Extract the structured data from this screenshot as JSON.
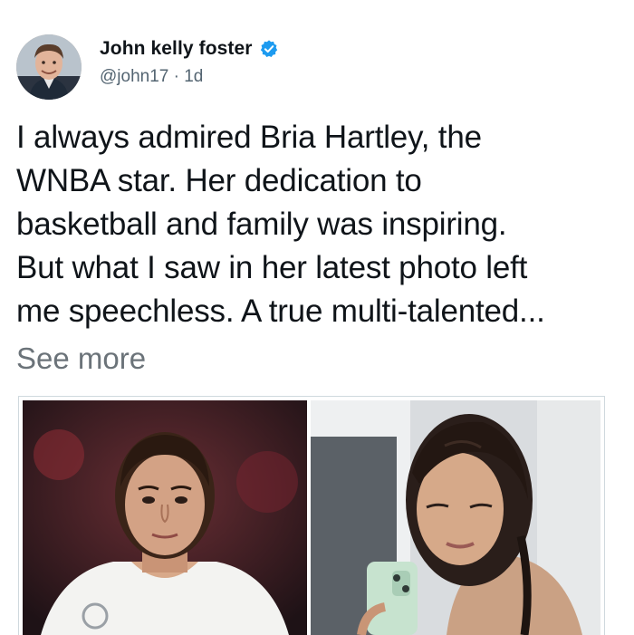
{
  "tweet": {
    "author": {
      "display_name": "John kelly foster",
      "handle": "@john17",
      "separator": "·",
      "time_ago": "1d",
      "verified": true,
      "avatar_icon": "profile-photo"
    },
    "text_lines": [
      "I always admired Bria Hartley, the",
      "WNBA star. Her dedication to",
      "basketball and family was inspiring.",
      "But what I saw in her latest photo left",
      "me speechless. A true multi-talented..."
    ],
    "see_more_label": "See more",
    "media": {
      "images": [
        {
          "icon": "basketball-player-photo"
        },
        {
          "icon": "selfie-photo"
        }
      ]
    }
  },
  "colors": {
    "text": "#0f1419",
    "secondary": "#536471",
    "see_more": "#6b7379",
    "verified_badge": "#1d9bf0"
  }
}
